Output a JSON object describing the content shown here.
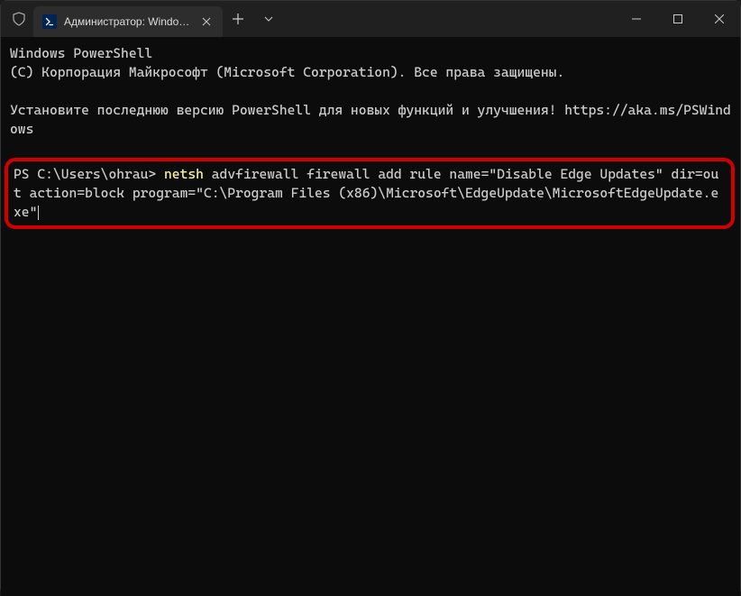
{
  "titlebar": {
    "tab_title": "Администратор: Windows PowerShell",
    "icon_label": "PS"
  },
  "terminal": {
    "line1": "Windows PowerShell",
    "line2": "(C) Корпорация Майкрософт (Microsoft Corporation). Все права защищены.",
    "line3": "Установите последнюю версию PowerShell для новых функций и улучшения! https://aka.ms/PSWindows",
    "prompt": "PS C:\\Users\\ohrau> ",
    "keyword": "netsh",
    "command_rest": " advfirewall firewall add rule name=\"Disable Edge Updates\" dir=out action=block program=\"C:\\Program Files (x86)\\Microsoft\\EdgeUpdate\\MicrosoftEdgeUpdate.exe\""
  }
}
